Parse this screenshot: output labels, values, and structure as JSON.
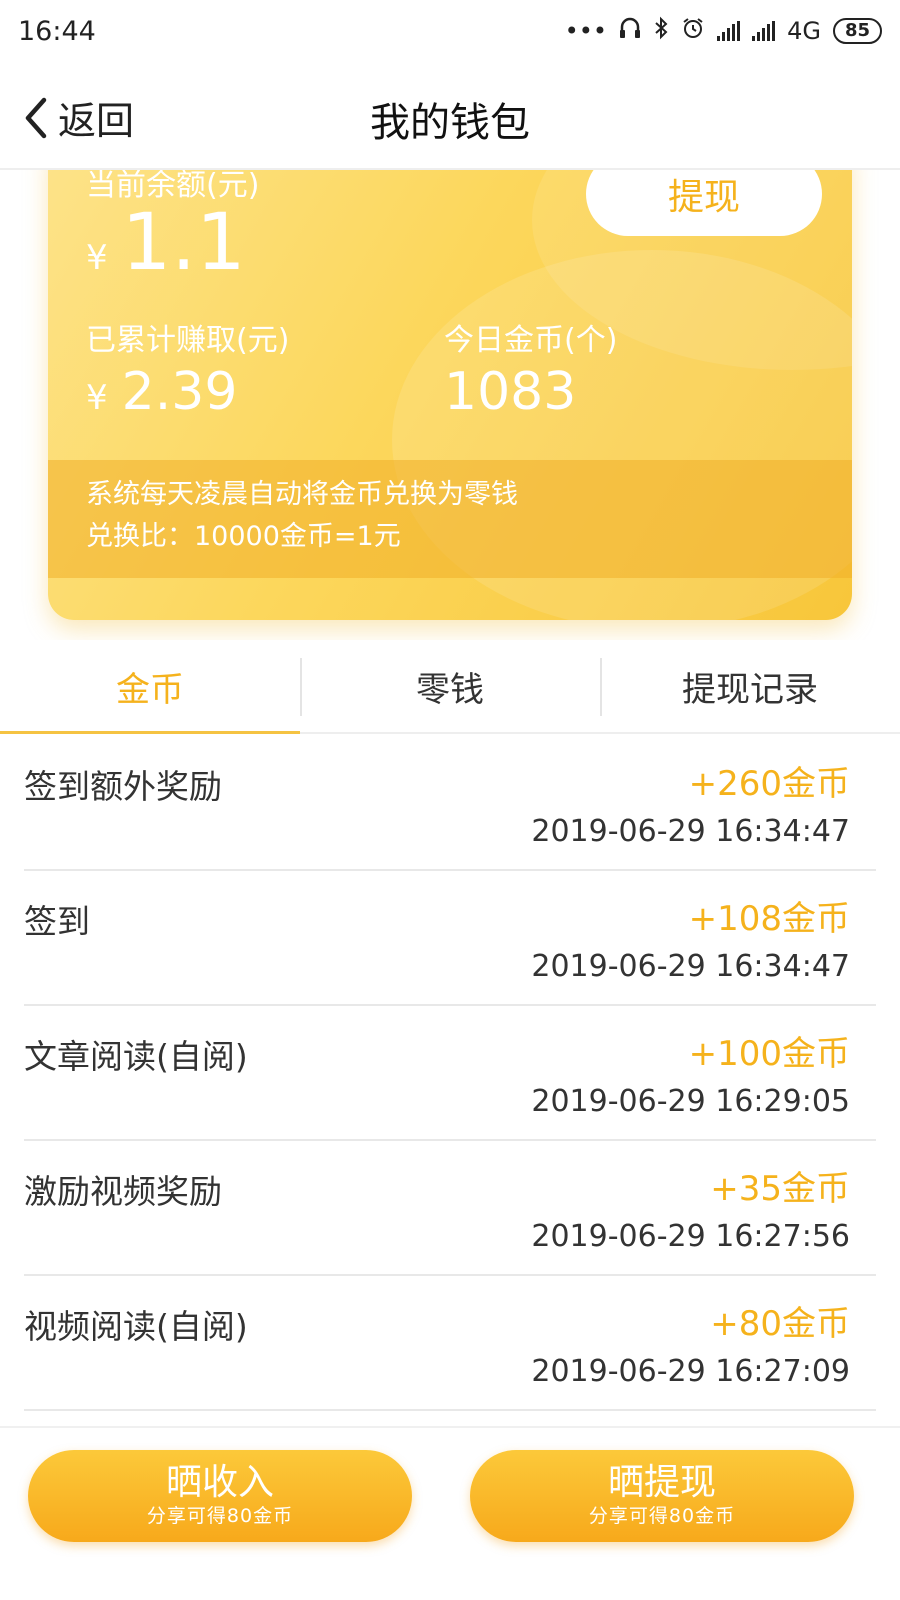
{
  "status_bar": {
    "time": "16:44",
    "network": "4G",
    "battery": "85",
    "icons": [
      "more-dots-icon",
      "headphone-icon",
      "bluetooth-icon",
      "alarm-icon",
      "signal-icon",
      "signal-icon"
    ]
  },
  "header": {
    "back_label": "返回",
    "title": "我的钱包"
  },
  "wallet": {
    "balance_label": "当前余额(元)",
    "currency_symbol": "¥",
    "balance_value": "1.1",
    "withdraw_label": "提现",
    "earned_label": "已累计赚取(元)",
    "earned_value": "2.39",
    "coins_label": "今日金币(个)",
    "coins_value": "1083",
    "notice_line1": "系统每天凌晨自动将金币兑换为零钱",
    "notice_line2": "兑换比：10000金币=1元"
  },
  "tabs": [
    {
      "label": "金币",
      "active": true
    },
    {
      "label": "零钱",
      "active": false
    },
    {
      "label": "提现记录",
      "active": false
    }
  ],
  "records": [
    {
      "title": "签到额外奖励",
      "amount": "+260金币",
      "time": "2019-06-29 16:34:47"
    },
    {
      "title": "签到",
      "amount": "+108金币",
      "time": "2019-06-29 16:34:47"
    },
    {
      "title": "文章阅读(自阅)",
      "amount": "+100金币",
      "time": "2019-06-29 16:29:05"
    },
    {
      "title": "激励视频奖励",
      "amount": "+35金币",
      "time": "2019-06-29 16:27:56"
    },
    {
      "title": "视频阅读(自阅)",
      "amount": "+80金币",
      "time": "2019-06-29 16:27:09"
    }
  ],
  "bottom_bar": {
    "share_income_label": "晒收入",
    "share_income_sub": "分享可得80金币",
    "share_withdraw_label": "晒提现",
    "share_withdraw_sub": "分享可得80金币"
  },
  "colors": {
    "accent": "#f5b21c",
    "card_gradient_start": "#fde38a",
    "card_gradient_end": "#f8c63a"
  }
}
